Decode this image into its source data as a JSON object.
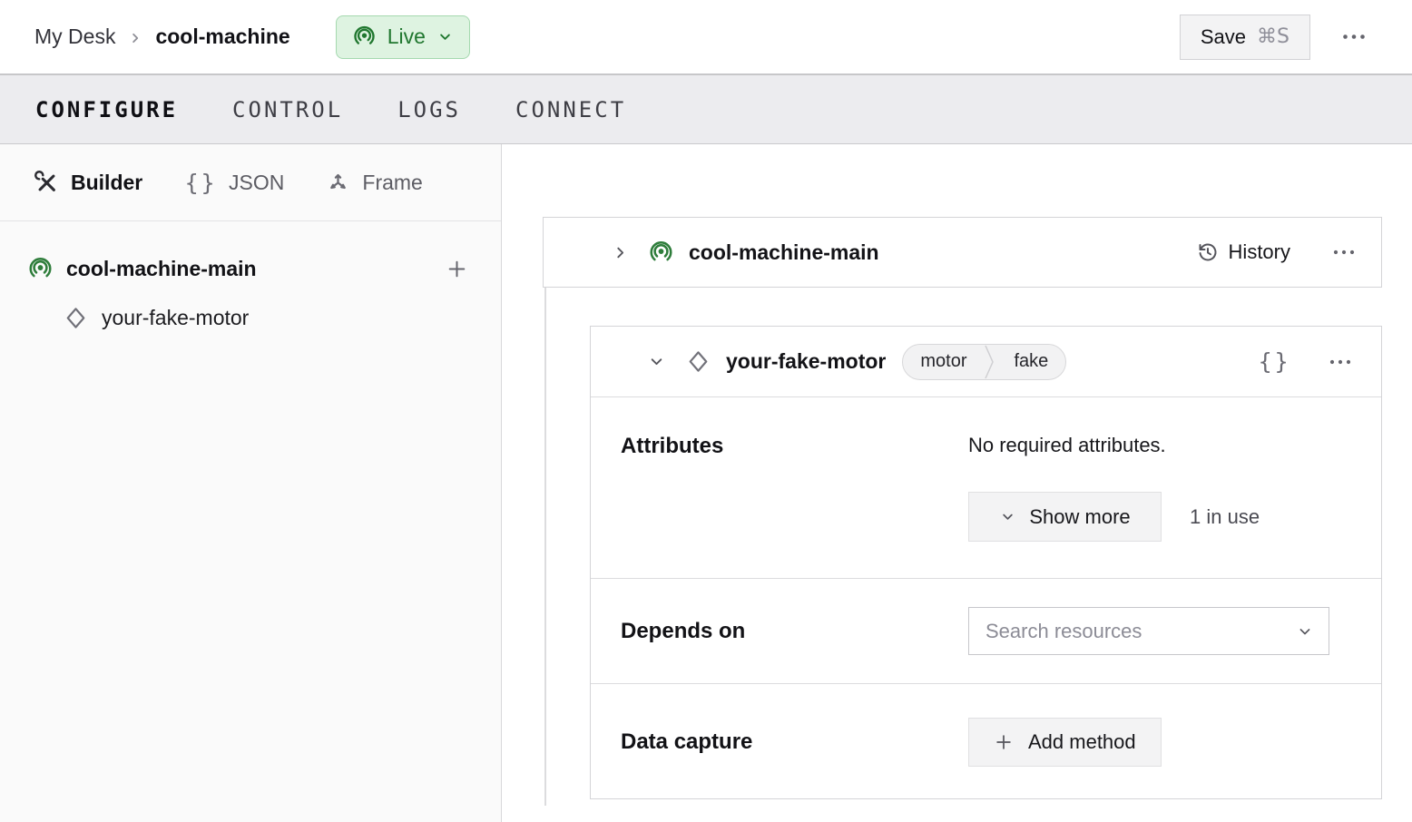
{
  "header": {
    "breadcrumb": {
      "parent": "My Desk",
      "current": "cool-machine"
    },
    "live_status": {
      "label": "Live"
    },
    "save_button": {
      "label": "Save",
      "shortcut": "⌘S"
    }
  },
  "tabs": [
    {
      "label": "CONFIGURE",
      "active": true
    },
    {
      "label": "CONTROL",
      "active": false
    },
    {
      "label": "LOGS",
      "active": false
    },
    {
      "label": "CONNECT",
      "active": false
    }
  ],
  "sidebar": {
    "modes": [
      {
        "label": "Builder",
        "icon": "tools-icon",
        "active": true
      },
      {
        "label": "JSON",
        "icon": "braces-icon",
        "active": false
      },
      {
        "label": "Frame",
        "icon": "frame-axes-icon",
        "active": false
      }
    ],
    "tree": {
      "root_label": "cool-machine-main",
      "child_label": "your-fake-motor"
    }
  },
  "main": {
    "part_card": {
      "title": "cool-machine-main",
      "history_label": "History"
    },
    "resource_card": {
      "title": "your-fake-motor",
      "tags": [
        "motor",
        "fake"
      ],
      "attributes": {
        "label": "Attributes",
        "empty_text": "No required attributes.",
        "show_more_label": "Show more",
        "usage_text": "1 in use"
      },
      "depends_on": {
        "label": "Depends on",
        "search_placeholder": "Search resources"
      },
      "data_capture": {
        "label": "Data capture",
        "add_method_label": "Add method"
      }
    }
  },
  "colors": {
    "accent_green": "#2e7d3b",
    "live_bg": "#def3e1",
    "live_border": "#a5d9af",
    "live_text": "#20772f",
    "tab_bar_bg": "#ececef",
    "sidebar_bg": "#fafafa",
    "border_gray": "#d4d4d7"
  },
  "icons": {
    "braces_glyph": "{}",
    "ellipsis_note": "three-dot overflow menu"
  }
}
